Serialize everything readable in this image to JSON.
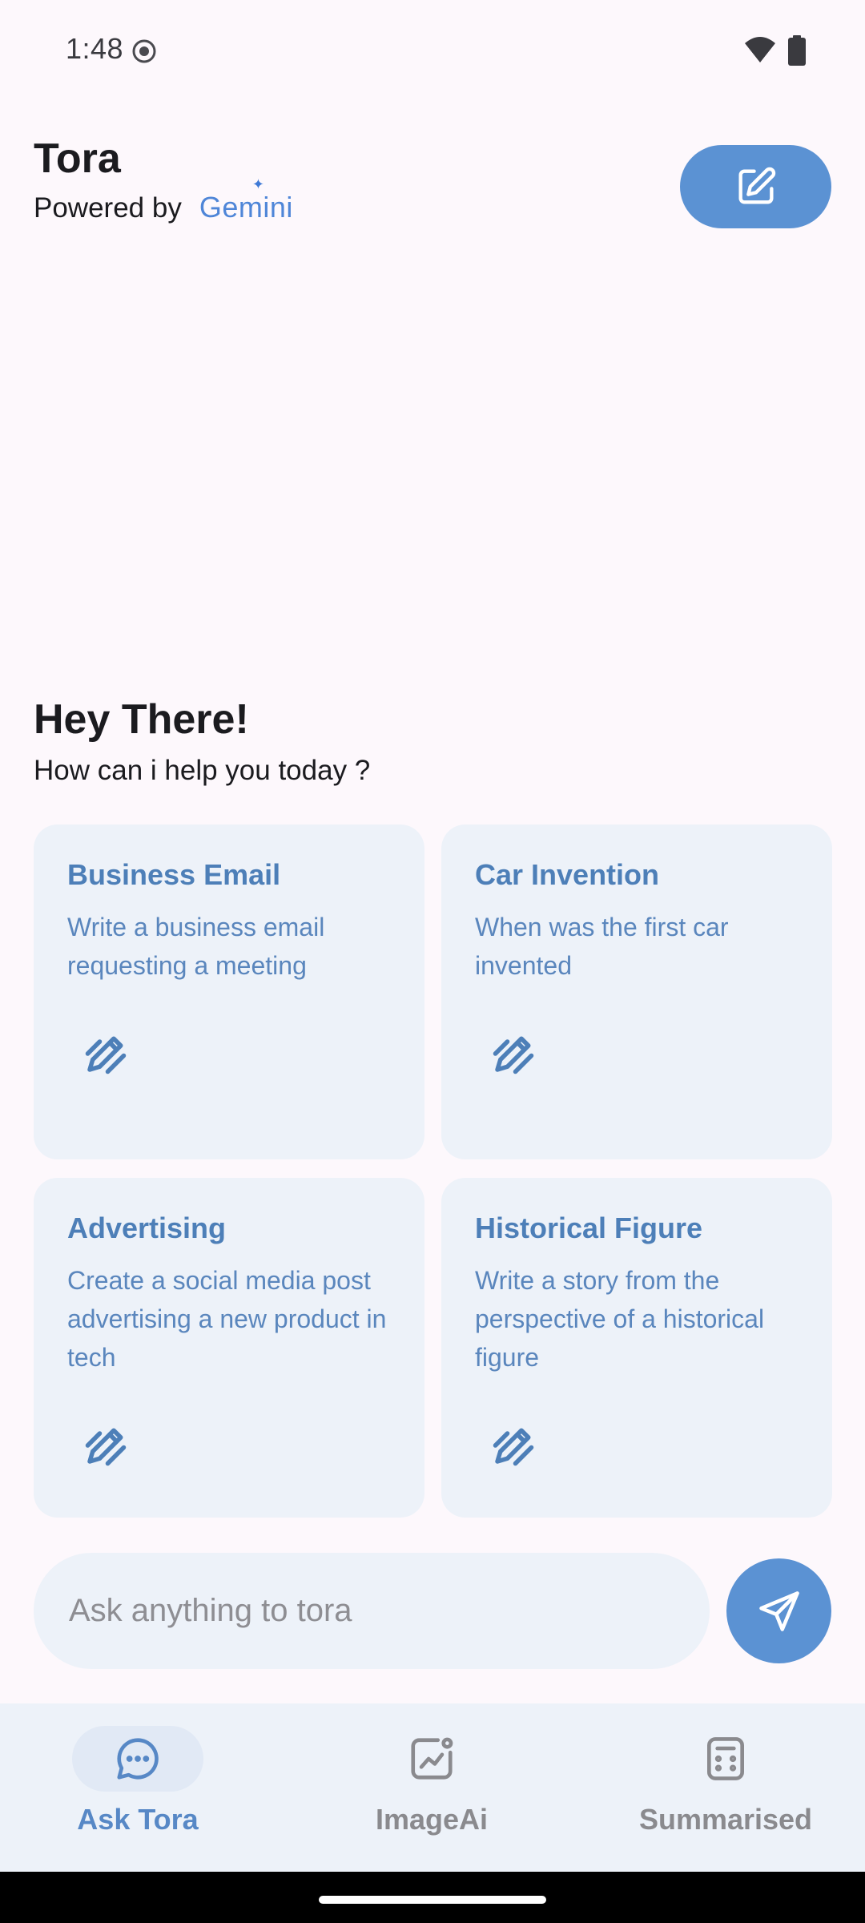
{
  "status_bar": {
    "time": "1:48"
  },
  "header": {
    "title": "Tora",
    "powered_by": "Powered by",
    "brand": "Gemini"
  },
  "greeting": {
    "title": "Hey There!",
    "subtitle": "How can i help you today ?"
  },
  "suggestions": [
    {
      "title": "Business Email",
      "description": "Write a business email requesting a meeting"
    },
    {
      "title": "Car Invention",
      "description": "When was the first car invented"
    },
    {
      "title": "Advertising",
      "description": "Create a social media post advertising a new product in tech"
    },
    {
      "title": "Historical Figure",
      "description": "Write a story from the perspective of a historical figure"
    }
  ],
  "input": {
    "placeholder": "Ask anything to tora",
    "value": ""
  },
  "bottom_nav": {
    "items": [
      {
        "label": "Ask Tora",
        "icon": "chat-bubble-icon",
        "active": true
      },
      {
        "label": "ImageAi",
        "icon": "image-trend-icon",
        "active": false
      },
      {
        "label": "Summarised",
        "icon": "calculator-icon",
        "active": false
      }
    ]
  },
  "colors": {
    "accent": "#5b92d3",
    "card_bg": "#edf2f9",
    "card_text": "#4d7fb8",
    "background": "#fdf8fc"
  }
}
